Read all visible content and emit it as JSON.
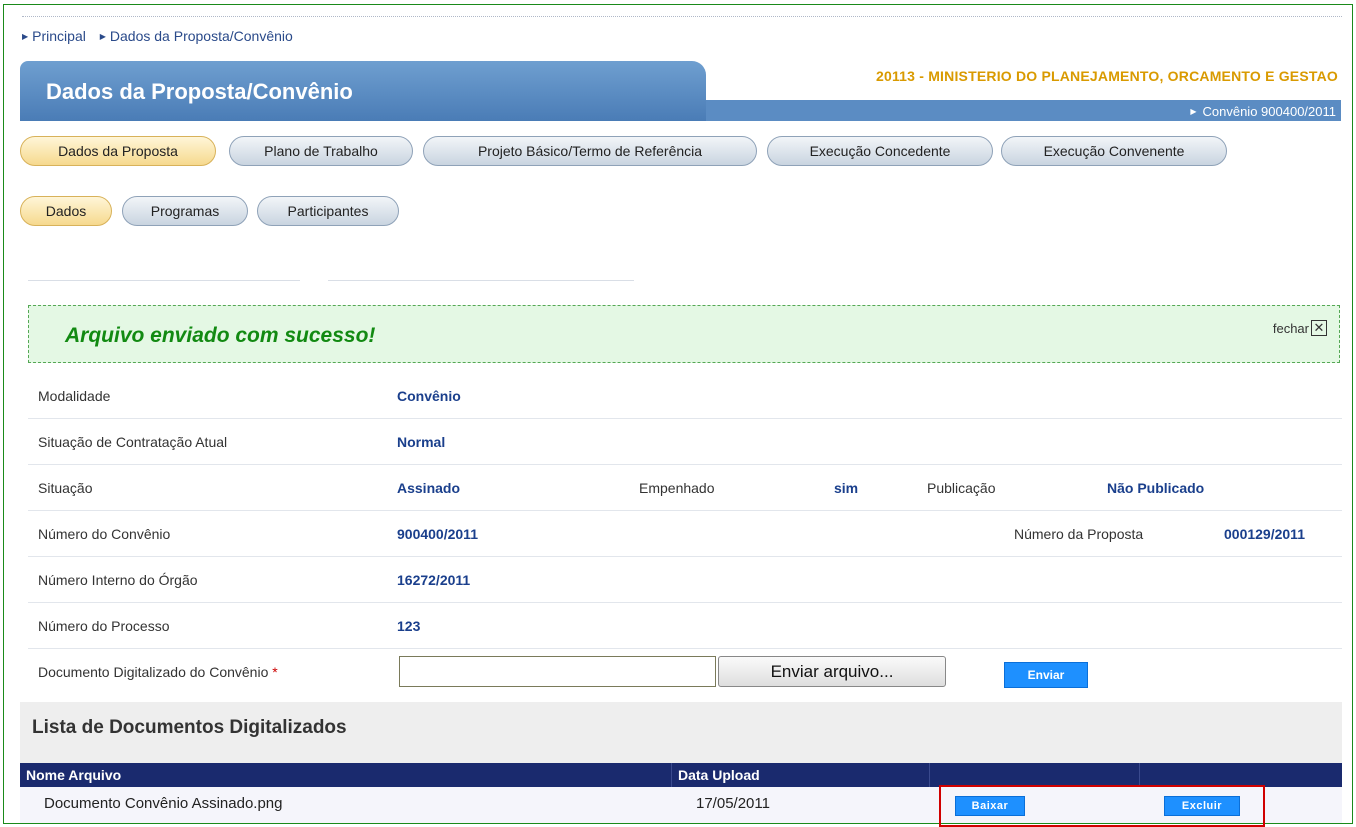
{
  "breadcrumb": {
    "items": [
      "Principal",
      "Dados da Proposta/Convênio"
    ]
  },
  "header": {
    "title": "Dados da Proposta/Convênio",
    "organization": "20113 - MINISTERIO DO PLANEJAMENTO, ORCAMENTO E GESTAO",
    "convenio": "Convênio 900400/2011"
  },
  "main_tabs": [
    "Dados da Proposta",
    "Plano de Trabalho",
    "Projeto Básico/Termo de Referência",
    "Execução Concedente",
    "Execução Convenente"
  ],
  "sub_tabs": [
    "Dados",
    "Programas",
    "Participantes"
  ],
  "alert": {
    "message": "Arquivo enviado com sucesso!",
    "close_label": "fechar"
  },
  "fields": {
    "modalidade_label": "Modalidade",
    "modalidade_value": "Convênio",
    "situacao_contratacao_label": "Situação de Contratação Atual",
    "situacao_contratacao_value": "Normal",
    "situacao_label": "Situação",
    "situacao_value": "Assinado",
    "empenhado_label": "Empenhado",
    "empenhado_value": "sim",
    "publicacao_label": "Publicação",
    "publicacao_value": "Não Publicado",
    "numero_convenio_label": "Número do Convênio",
    "numero_convenio_value": "900400/2011",
    "numero_proposta_label": "Número da Proposta",
    "numero_proposta_value": "000129/2011",
    "numero_interno_label": "Número Interno do Órgão",
    "numero_interno_value": "16272/2011",
    "numero_processo_label": "Número do Processo",
    "numero_processo_value": "123",
    "documento_label": "Documento Digitalizado do Convênio",
    "required_mark": "*",
    "file_value": "",
    "file_button": "Enviar arquivo...",
    "send_button": "Enviar"
  },
  "documents": {
    "title": "Lista de Documentos Digitalizados",
    "columns": [
      "Nome Arquivo",
      "Data Upload",
      "",
      ""
    ],
    "rows": [
      {
        "name": "Documento Convênio Assinado.png",
        "date": "17/05/2011",
        "download": "Baixar",
        "delete": "Excluir"
      }
    ]
  },
  "colors": {
    "header_blue": "#5b8cc3",
    "org_gold": "#d99a00",
    "success_green": "#128a12",
    "table_header": "#1a2a6e",
    "button_blue": "#1e90ff",
    "highlight_red": "#d00000"
  }
}
